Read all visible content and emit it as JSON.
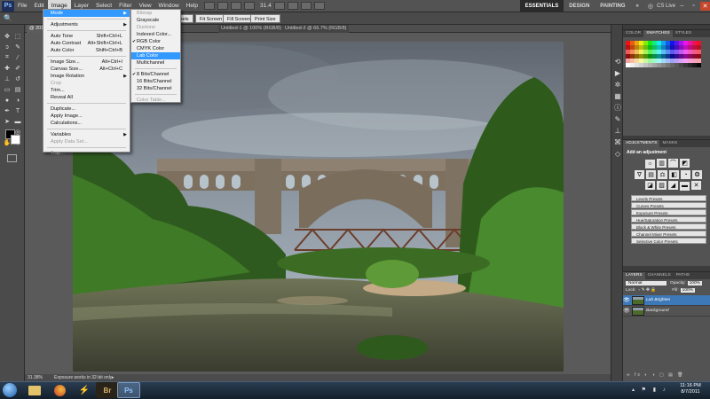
{
  "app": {
    "logo": "Ps",
    "menu": [
      "File",
      "Edit",
      "Image",
      "Layer",
      "Select",
      "Filter",
      "View",
      "Window",
      "Help"
    ],
    "active_menu": "Image",
    "zoom": "31.4",
    "workspaces": [
      "ESSENTIALS",
      "DESIGN",
      "PAINTING",
      "»"
    ],
    "active_workspace": "ESSENTIALS",
    "cs_live": "CS Live"
  },
  "options_bar": {
    "buttons": [
      "Pixels",
      "Fit Screen",
      "Fill Screen",
      "Print Size"
    ]
  },
  "tabs": [
    {
      "label": "@ 20110",
      "active": true
    },
    {
      "label": "Untitled-1 @ 100% (RGB/8)",
      "active": false
    },
    {
      "label": "Untitled-2 @ 66.7% (RGB/8)",
      "active": false
    }
  ],
  "image_menu": {
    "items": [
      {
        "label": "Mode",
        "shortcut": "",
        "submenu": true,
        "selected": true,
        "disabled": false
      },
      {
        "sep": true
      },
      {
        "label": "Adjustments",
        "shortcut": "",
        "submenu": true,
        "selected": false,
        "disabled": false
      },
      {
        "sep": true
      },
      {
        "label": "Auto Tone",
        "shortcut": "Shift+Ctrl+L",
        "submenu": false,
        "selected": false,
        "disabled": false
      },
      {
        "label": "Auto Contrast",
        "shortcut": "Alt+Shift+Ctrl+L",
        "submenu": false,
        "selected": false,
        "disabled": false
      },
      {
        "label": "Auto Color",
        "shortcut": "Shift+Ctrl+B",
        "submenu": false,
        "selected": false,
        "disabled": false
      },
      {
        "sep": true
      },
      {
        "label": "Image Size...",
        "shortcut": "Alt+Ctrl+I",
        "submenu": false,
        "selected": false,
        "disabled": false
      },
      {
        "label": "Canvas Size...",
        "shortcut": "Alt+Ctrl+C",
        "submenu": false,
        "selected": false,
        "disabled": false
      },
      {
        "label": "Image Rotation",
        "shortcut": "",
        "submenu": true,
        "selected": false,
        "disabled": false
      },
      {
        "label": "Crop",
        "shortcut": "",
        "submenu": false,
        "selected": false,
        "disabled": true
      },
      {
        "label": "Trim...",
        "shortcut": "",
        "submenu": false,
        "selected": false,
        "disabled": false
      },
      {
        "label": "Reveal All",
        "shortcut": "",
        "submenu": false,
        "selected": false,
        "disabled": false
      },
      {
        "sep": true
      },
      {
        "label": "Duplicate...",
        "shortcut": "",
        "submenu": false,
        "selected": false,
        "disabled": false
      },
      {
        "label": "Apply Image...",
        "shortcut": "",
        "submenu": false,
        "selected": false,
        "disabled": false
      },
      {
        "label": "Calculations...",
        "shortcut": "",
        "submenu": false,
        "selected": false,
        "disabled": false
      },
      {
        "sep": true
      },
      {
        "label": "Variables",
        "shortcut": "",
        "submenu": true,
        "selected": false,
        "disabled": false
      },
      {
        "label": "Apply Data Set...",
        "shortcut": "",
        "submenu": false,
        "selected": false,
        "disabled": true
      },
      {
        "sep": true
      },
      {
        "label": "Trap...",
        "shortcut": "",
        "submenu": false,
        "selected": false,
        "disabled": true
      }
    ]
  },
  "mode_menu": {
    "items": [
      {
        "label": "Bitmap",
        "checked": false,
        "disabled": true,
        "selected": false
      },
      {
        "label": "Grayscale",
        "checked": false,
        "disabled": false,
        "selected": false
      },
      {
        "label": "Duotone",
        "checked": false,
        "disabled": true,
        "selected": false
      },
      {
        "label": "Indexed Color...",
        "checked": false,
        "disabled": false,
        "selected": false
      },
      {
        "label": "RGB Color",
        "checked": true,
        "disabled": false,
        "selected": false
      },
      {
        "label": "CMYK Color",
        "checked": false,
        "disabled": false,
        "selected": false
      },
      {
        "label": "Lab Color",
        "checked": false,
        "disabled": false,
        "selected": true
      },
      {
        "label": "Multichannel",
        "checked": false,
        "disabled": false,
        "selected": false
      },
      {
        "sep": true
      },
      {
        "label": "8 Bits/Channel",
        "checked": true,
        "disabled": false,
        "selected": false
      },
      {
        "label": "16 Bits/Channel",
        "checked": false,
        "disabled": false,
        "selected": false
      },
      {
        "label": "32 Bits/Channel",
        "checked": false,
        "disabled": false,
        "selected": false
      },
      {
        "sep": true
      },
      {
        "label": "Color Table...",
        "checked": false,
        "disabled": true,
        "selected": false
      }
    ]
  },
  "status": {
    "zoom": "31.38%",
    "info": "Exposure works in 32-bit only"
  },
  "panels": {
    "swatch_tabs": [
      "COLOR",
      "SWATCHES",
      "STYLES"
    ],
    "adjust_tabs": [
      "ADJUSTMENTS",
      "MASKS"
    ],
    "adjust_title": "Add an adjustment",
    "presets": [
      "Levels Presets",
      "Curves Presets",
      "Exposure Presets",
      "Hue/Saturation Presets",
      "Black & White Presets",
      "Channel Mixer Presets",
      "Selective Color Presets"
    ],
    "layer_tabs": [
      "LAYERS",
      "CHANNELS",
      "PATHS"
    ],
    "blend_mode": "Normal",
    "opacity_label": "Opacity:",
    "opacity": "100%",
    "lock_label": "Lock:",
    "fill_label": "Fill:",
    "fill": "100%",
    "layers": [
      {
        "name": "Lab Brighten",
        "selected": true
      },
      {
        "name": "Background",
        "selected": false
      }
    ]
  },
  "taskbar": {
    "apps": [
      "Br",
      "Ps"
    ],
    "time": "11:16 PM",
    "date": "8/7/2011"
  }
}
